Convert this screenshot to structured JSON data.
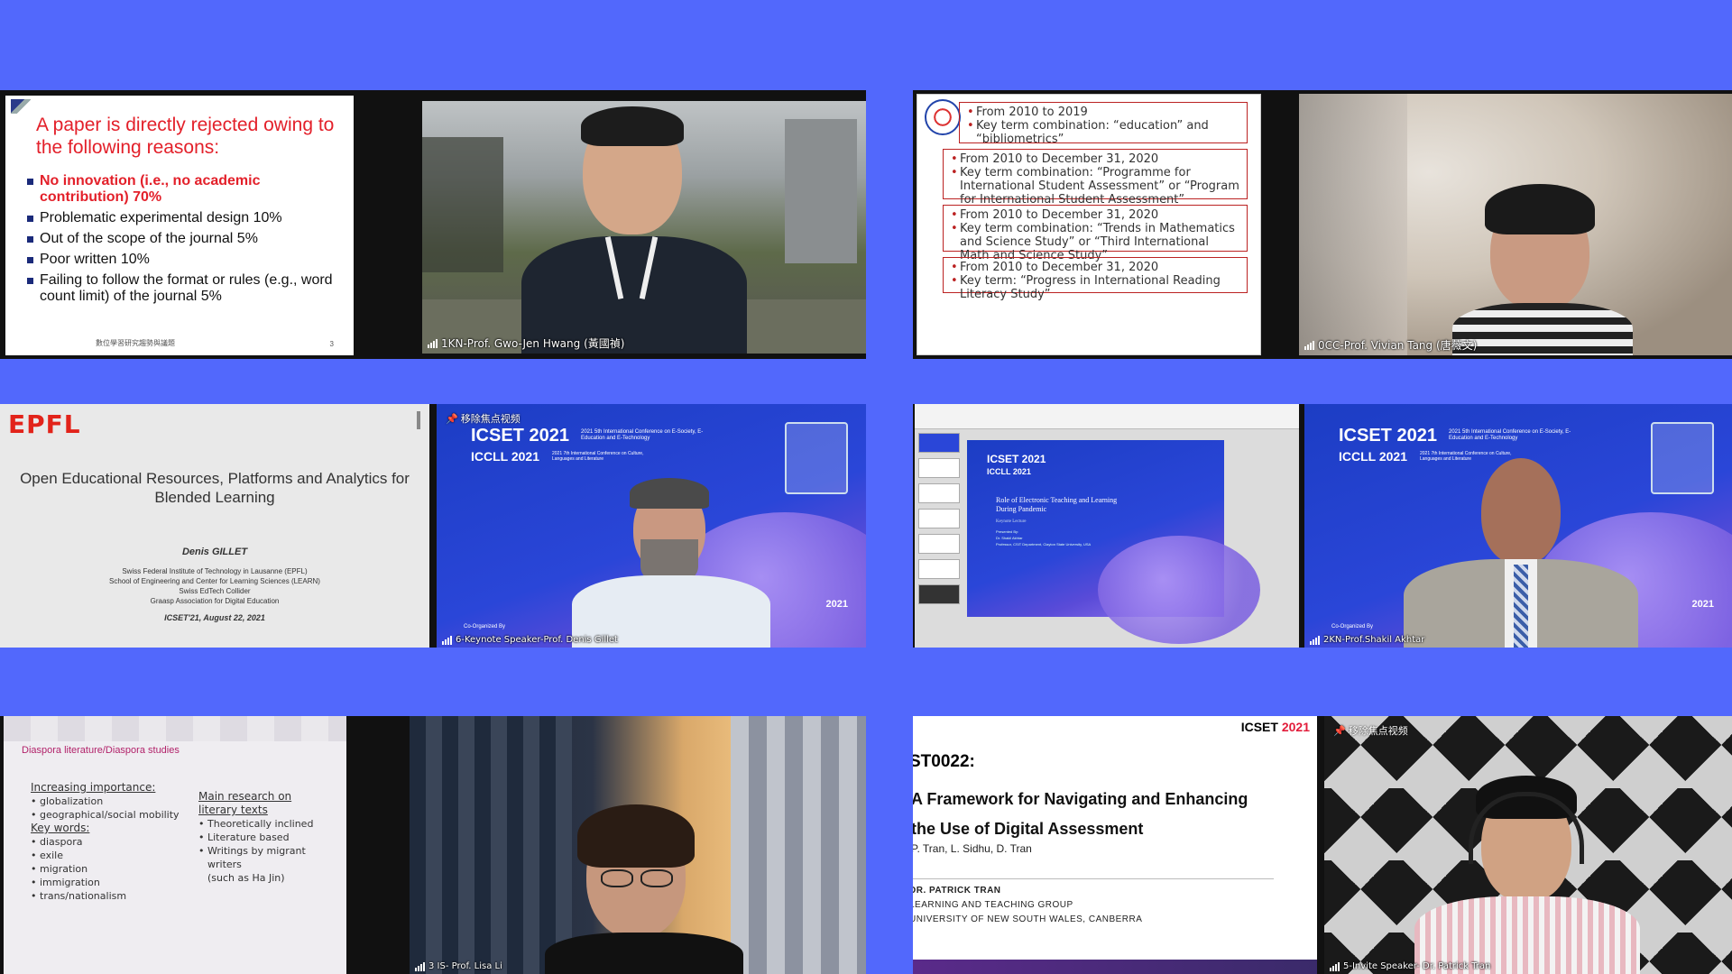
{
  "app": "Video Conference Gallery",
  "tiles": {
    "t1": {
      "slide": {
        "title": "A paper is directly rejected owing to the following reasons:",
        "items": [
          {
            "text": "No innovation (i.e., no academic contribution) 70%",
            "highlight": true
          },
          {
            "text": "Problematic experimental design 10%",
            "highlight": false
          },
          {
            "text": "Out of the scope of the journal 5%",
            "highlight": false
          },
          {
            "text": "Poor written 10%",
            "highlight": false
          },
          {
            "text": "Failing to follow the format or rules (e.g., word count limit) of the journal 5%",
            "highlight": false
          }
        ],
        "footer": "數位學習研究趨勢與議題",
        "page": "3"
      },
      "name": "1KN-Prof. Gwo-Jen Hwang (黃國禎)"
    },
    "t2": {
      "boxes": [
        [
          "From 2010 to 2019",
          "Key term combination: “education” and “bibliometrics”"
        ],
        [
          "From 2010 to December 31, 2020",
          "Key term combination: “Programme for International Student Assessment” or “Program for International Student Assessment”"
        ],
        [
          "From 2010 to December 31, 2020",
          "Key term combination: “Trends in Mathematics and Science Study” or “Third International Math and Science Study”"
        ],
        [
          "From 2010 to December 31, 2020",
          "Key term: “Progress in International Reading Literacy Study”"
        ]
      ],
      "name": "0CC-Prof. Vivian Tang (唐薇文)"
    },
    "t3": {
      "logo": "EPFL",
      "title": "Open Educational Resources, Platforms and Analytics for Blended Learning",
      "author": "Denis GILLET",
      "affiliations": [
        "Swiss Federal Institute of Technology in Lausanne (EPFL)",
        "School of Engineering and Center for Learning Sciences (LEARN)",
        "Swiss EdTech Collider",
        "Graasp Association for Digital Education"
      ],
      "date": "ICSET'21, August 22, 2021",
      "unpin": "移除焦点视频",
      "name": "6-Keynote Speaker-Prof. Denis Gillet"
    },
    "t4": {
      "slide_title": "Role of Electronic Teaching and Learning During Pandemic",
      "slide_sub": "Keynote Lecture",
      "presenter": [
        "Presented By:",
        "Dr. Shakil Akhtar",
        "Professor, CSIT Department, Clayton State University, USA"
      ],
      "name": "2KN-Prof.Shakil Akhtar"
    },
    "icset": {
      "h1": "ICSET 2021",
      "h2": "ICCLL 2021",
      "sub": "2021 5th International Conference on E-Society, E-Education and E-Technology",
      "sub2": "2021 7th International Conference on Culture, Languages and Literature",
      "date": "2021",
      "coorg": "Co-Organized By"
    },
    "t5": {
      "title": "Diaspora literature/Diaspora studies",
      "left_col": {
        "heading1": "Increasing importance:",
        "items1": [
          "globalization",
          "geographical/social mobility"
        ],
        "heading2": "Key words:",
        "items2": [
          "diaspora",
          "exile",
          "migration",
          "immigration",
          "trans/nationalism"
        ]
      },
      "right_col": {
        "heading": "Main research on literary texts",
        "items": [
          "Theoretically inclined",
          "Literature based",
          "Writings by migrant writers"
        ],
        "note": "(such as Ha Jin)"
      },
      "name": "3 IS- Prof. Lisa Li"
    },
    "t6": {
      "brand": "ICSET",
      "brand_year": "2021",
      "code": "ST0022:",
      "title": [
        "A Framework for Navigating and Enhancing",
        "the Use of Digital Assessment"
      ],
      "authors": "P. Tran, L. Sidhu, D. Tran",
      "presenter": "DR. PATRICK TRAN",
      "group": "LEARNING AND TEACHING GROUP",
      "uni": "UNIVERSITY OF NEW SOUTH WALES, CANBERRA",
      "unpin": "移除焦点视频",
      "name": "5-Invite Speaker- Dr. Patrick Tran"
    }
  },
  "colors": {
    "background": "#5268fc",
    "slide_red": "#e3202a",
    "icset_blue": "#2a46d8"
  }
}
